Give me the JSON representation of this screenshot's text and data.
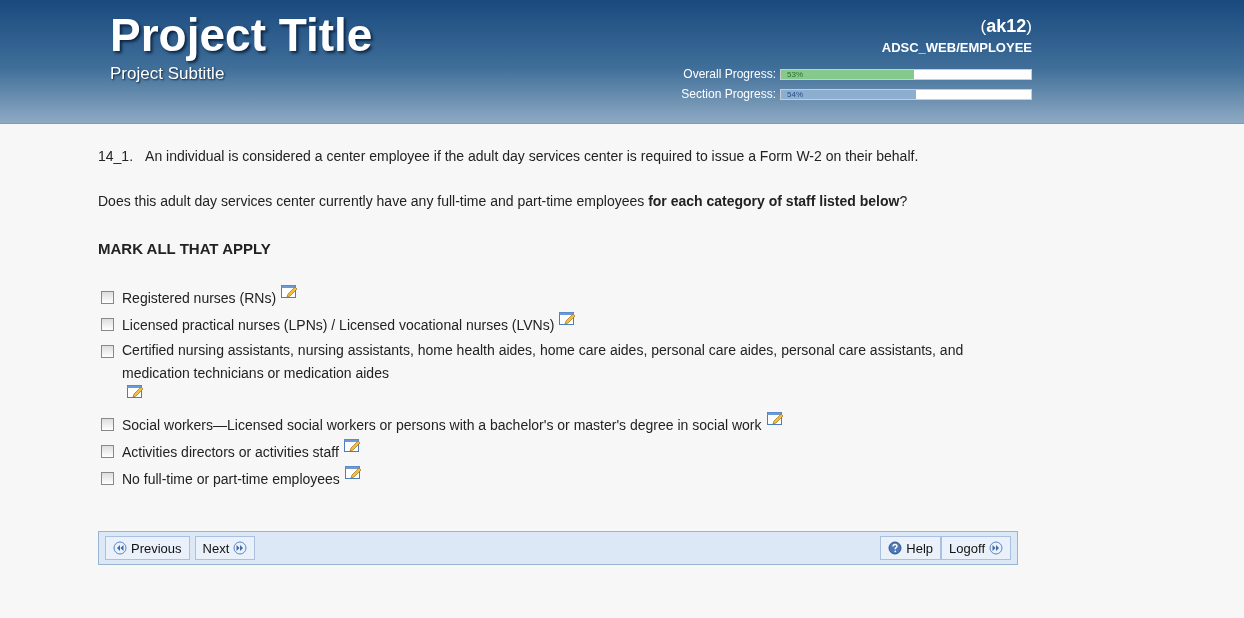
{
  "header": {
    "title": "Project Title",
    "subtitle": "Project Subtitle",
    "user": "(**ak12**)",
    "path": "ADSC_WEB/EMPLOYEE",
    "progress": [
      {
        "label": "Overall Progress:",
        "reading": "53%",
        "level": 0.53,
        "color": "#85c98c"
      },
      {
        "label": "Section Progress:",
        "reading": "54%",
        "level": 0.54,
        "color": "#8eaed0"
      }
    ]
  },
  "question": {
    "number": "14_1.",
    "intro": "An individual is considered a center employee if the adult day services center is required to issue a Form W-2 on their behalf.",
    "prompt": "Does this adult day services center currently have any full-time and part-time employees **for each category of staff listed below**?",
    "instruction": "MARK ALL THAT APPLY"
  },
  "options": [
    {
      "label": "Registered nurses (RNs)",
      "checked": false
    },
    {
      "label": "Licensed practical nurses (LPNs) / Licensed vocational nurses (LVNs)",
      "checked": false
    },
    {
      "label": "Certified nursing assistants, nursing assistants, home health aides, home care aides, personal care aides, personal care assistants, and medication technicians or medication aides",
      "checked": false
    },
    {
      "label": "Social workers—Licensed social workers or persons with a bachelor's or master's degree in social work",
      "checked": false
    },
    {
      "label": "Activities directors or activities staff",
      "checked": false
    },
    {
      "label": "No full-time or part-time employees",
      "checked": false
    }
  ],
  "nav_left": [
    {
      "label": "Previous",
      "kind": "back"
    },
    {
      "label": "Next",
      "kind": "forward"
    }
  ],
  "nav_right": [
    {
      "label": "Help",
      "kind": "help"
    },
    {
      "label": "Logoff",
      "kind": "forward"
    }
  ]
}
